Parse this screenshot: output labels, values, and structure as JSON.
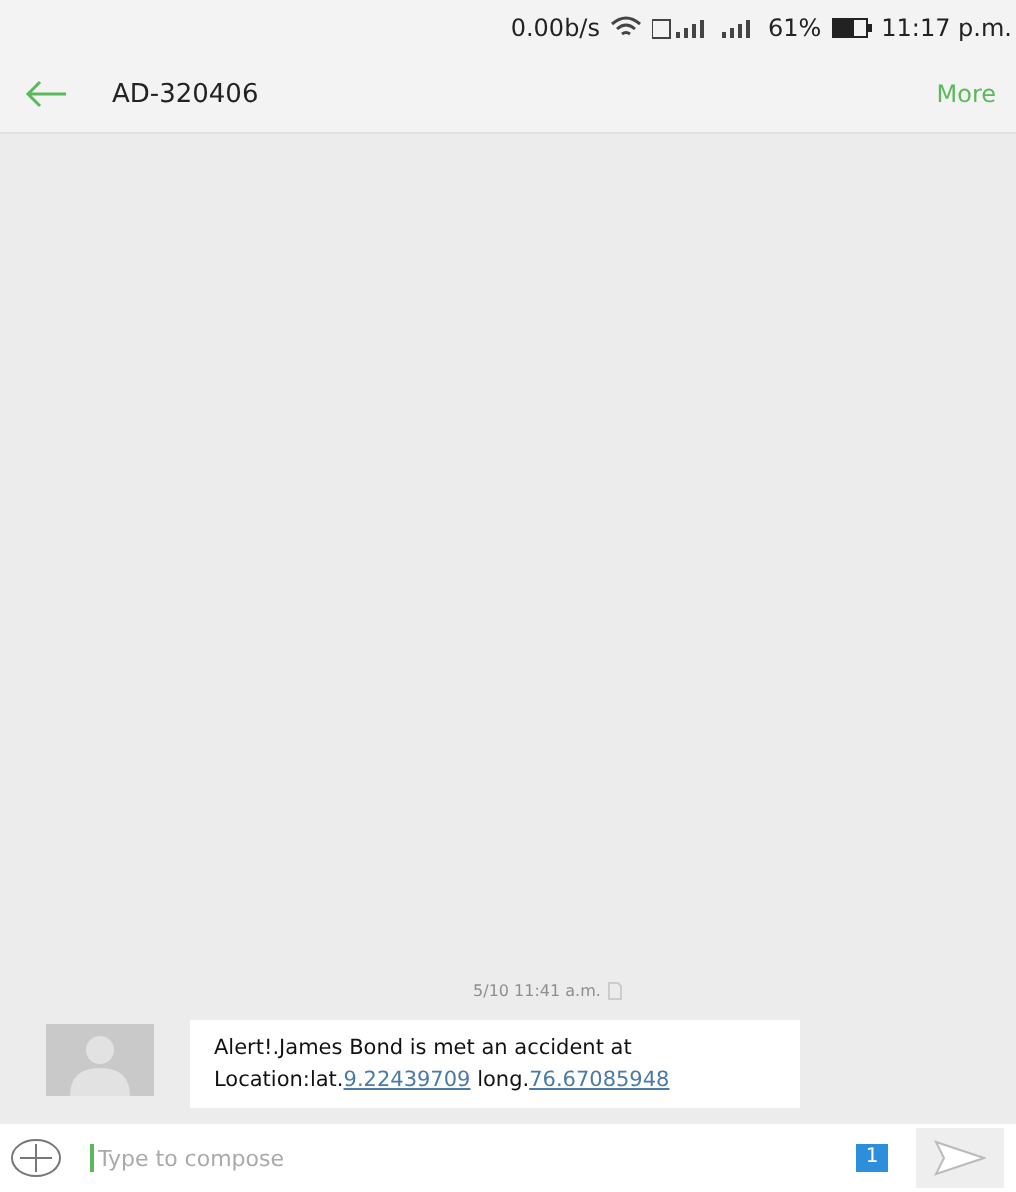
{
  "status_bar": {
    "speed": "0.00b/s",
    "battery": "61%",
    "time": "11:17 p.m."
  },
  "header": {
    "title": "AD-320406",
    "action": "More"
  },
  "conversation": {
    "timestamp": "5/10 11:41 a.m.",
    "message": [
      {
        "kind": "text",
        "text": "Alert!.James Bond is met an accident at Location:lat."
      },
      {
        "kind": "link",
        "text": "9.22439709"
      },
      {
        "kind": "text",
        "text": " long."
      },
      {
        "kind": "link",
        "text": "76.67085948"
      }
    ]
  },
  "compose": {
    "placeholder": "Type to compose",
    "sim": "1"
  }
}
